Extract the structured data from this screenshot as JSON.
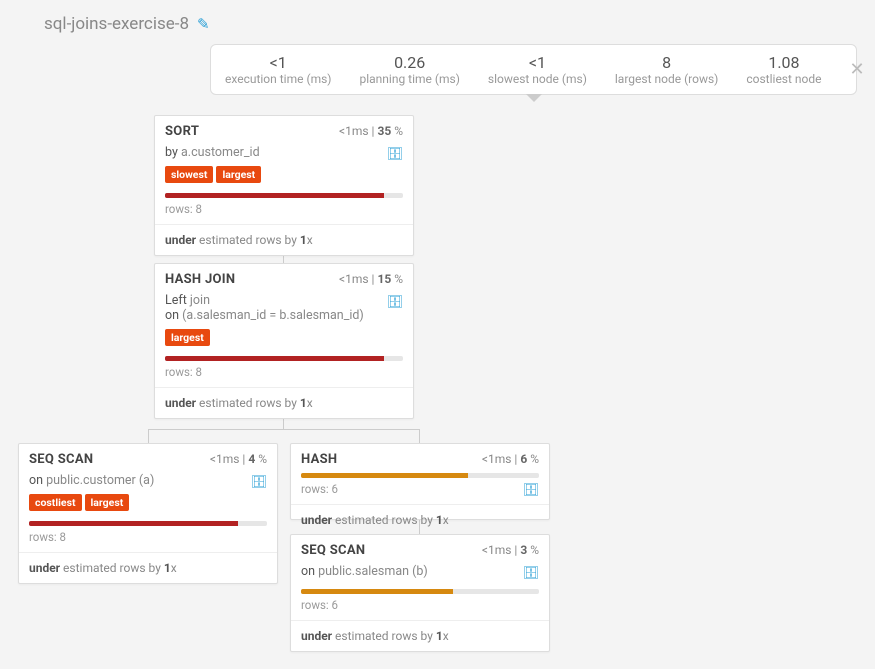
{
  "title": "sql-joins-exercise-8",
  "stats": [
    {
      "value": "<1",
      "label": "execution time (ms)"
    },
    {
      "value": "0.26",
      "label": "planning time (ms)"
    },
    {
      "value": "<1",
      "label": "slowest node (ms)"
    },
    {
      "value": "8",
      "label": "largest node (rows)"
    },
    {
      "value": "1.08",
      "label": "costliest node"
    }
  ],
  "nodes": {
    "sort": {
      "title": "SORT",
      "time": "<1ms",
      "pct": "35",
      "line1_pre": "by",
      "line1": "a.customer_id",
      "badges": [
        "slowest",
        "largest"
      ],
      "bar_color": "bar-red",
      "bar_pct": 92,
      "rows": "rows: 8",
      "foot_b1": "under",
      "foot_mid": " estimated rows by ",
      "foot_b2": "1",
      "foot_suffix": "x"
    },
    "hashjoin": {
      "title": "HASH JOIN",
      "time": "<1ms",
      "pct": "15",
      "line1_pre": "Left ",
      "line1": "join",
      "line2_pre": "on ",
      "line2": "(a.salesman_id = b.salesman_id)",
      "badges": [
        "largest"
      ],
      "bar_color": "bar-red",
      "bar_pct": 92,
      "rows": "rows: 8",
      "foot_b1": "under",
      "foot_mid": " estimated rows by ",
      "foot_b2": "1",
      "foot_suffix": "x"
    },
    "seqscan1": {
      "title": "SEQ SCAN",
      "time": "<1ms",
      "pct": "4",
      "line1_pre": "on ",
      "line1": "public.customer (a)",
      "badges": [
        "costliest",
        "largest"
      ],
      "bar_color": "bar-red",
      "bar_pct": 88,
      "rows": "rows: 8",
      "foot_b1": "under",
      "foot_mid": " estimated rows by ",
      "foot_b2": "1",
      "foot_suffix": "x"
    },
    "hash": {
      "title": "HASH",
      "time": "<1ms",
      "pct": "6",
      "bar_color": "bar-orange",
      "bar_pct": 70,
      "rows": "rows: 6",
      "foot_b1": "under",
      "foot_mid": " estimated rows by ",
      "foot_b2": "1",
      "foot_suffix": "x"
    },
    "seqscan2": {
      "title": "SEQ SCAN",
      "time": "<1ms",
      "pct": "3",
      "line1_pre": "on ",
      "line1": "public.salesman (b)",
      "bar_color": "bar-orange",
      "bar_pct": 64,
      "rows": "rows: 6",
      "foot_b1": "under",
      "foot_mid": " estimated rows by ",
      "foot_b2": "1",
      "foot_suffix": "x"
    }
  }
}
